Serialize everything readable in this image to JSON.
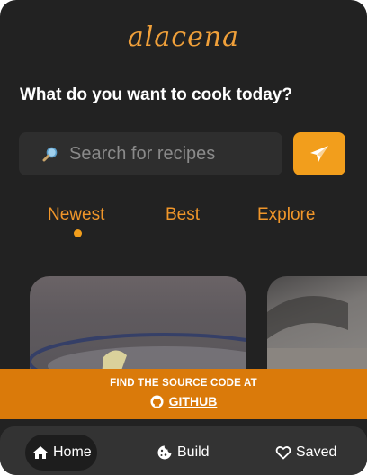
{
  "app": {
    "logo_text": "alacena"
  },
  "hero": {
    "headline": "What do you want to cook today?"
  },
  "search": {
    "placeholder": "Search for recipes",
    "icon": "search-icon"
  },
  "send": {
    "icon": "paper-plane-icon"
  },
  "tabs": [
    {
      "label": "Newest",
      "active": true
    },
    {
      "label": "Best",
      "active": false
    },
    {
      "label": "Explore",
      "active": false
    }
  ],
  "banner": {
    "title": "FIND THE SOURCE CODE AT",
    "link_label": "GITHUB",
    "icon": "github-icon"
  },
  "nav": [
    {
      "label": "Home",
      "icon": "home-icon",
      "active": true
    },
    {
      "label": "Build",
      "icon": "cookie-icon",
      "active": false
    },
    {
      "label": "Saved",
      "icon": "heart-icon",
      "active": false
    }
  ],
  "colors": {
    "accent": "#f29e1c",
    "banner": "#da7a0a",
    "background": "#222222",
    "nav_background": "#333333"
  }
}
